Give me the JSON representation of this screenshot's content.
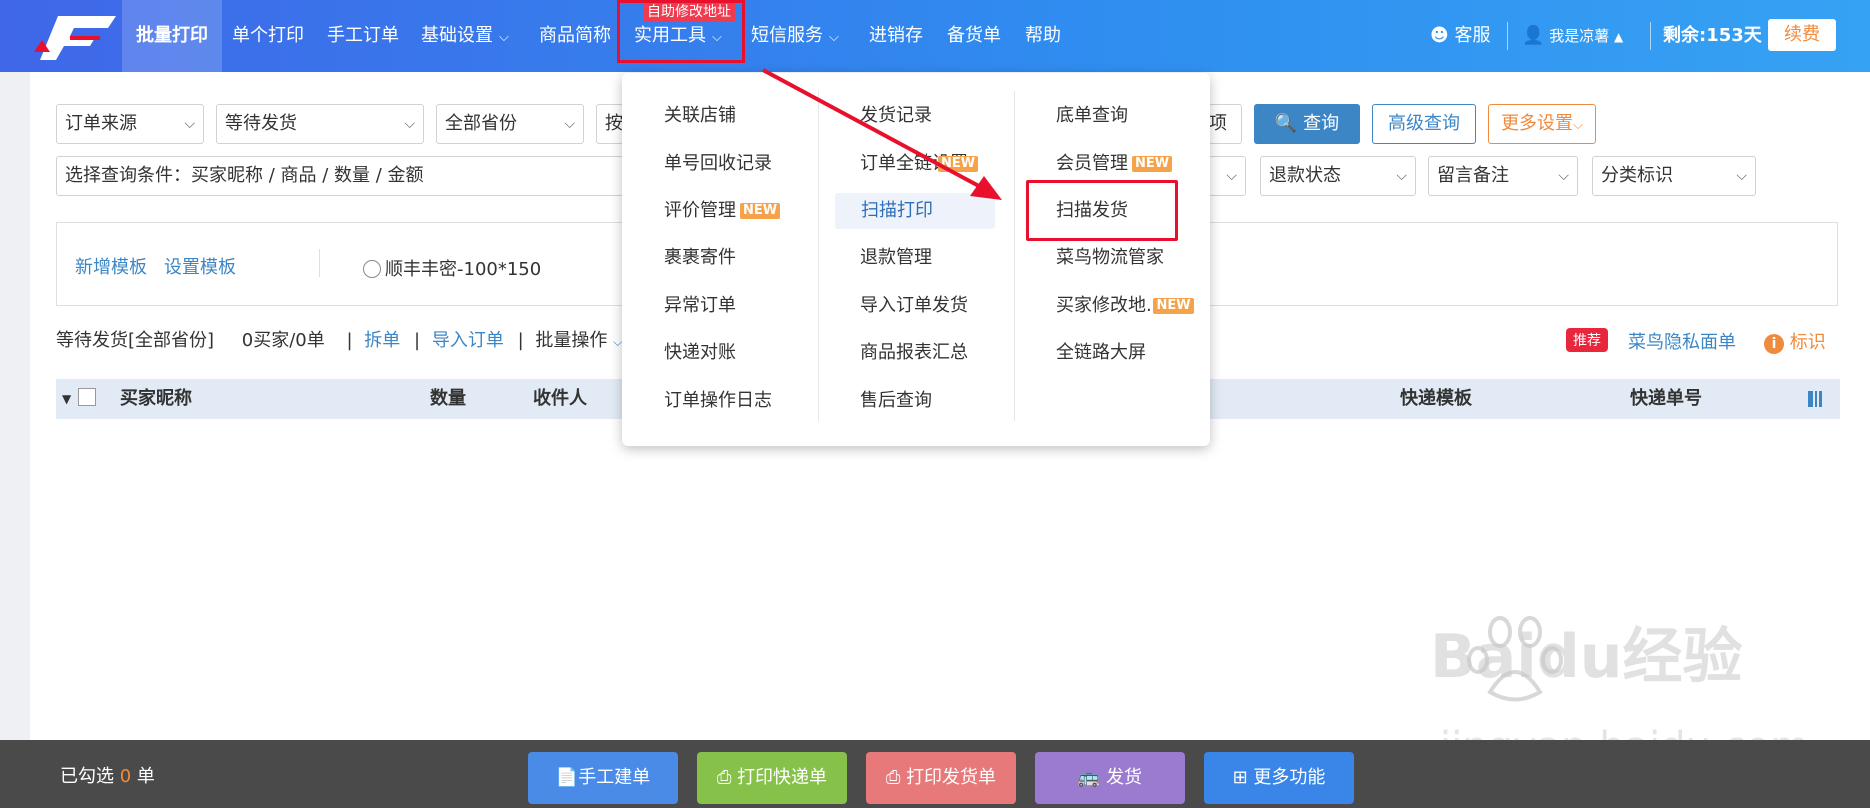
{
  "nav": {
    "items": [
      "批量打印",
      "单个打印",
      "手工订单",
      "基础设置",
      "商品简称",
      "实用工具",
      "短信服务",
      "进销存",
      "备货单",
      "帮助"
    ],
    "top_badge": "自助修改地址",
    "service": "客服",
    "user": "我是凉薯",
    "remaining": "剩余:153天",
    "renew": "续费"
  },
  "filters": {
    "order_source": "订单来源",
    "status": "等待发货",
    "province": "全部省份",
    "partial": "按",
    "item_tail": "项",
    "query": "查询",
    "advanced": "高级查询",
    "more_settings": "更多设置",
    "condition": "选择查询条件：买家昵称 / 商品 / 数量 / 金额",
    "refund": "退款状态",
    "remark": "留言备注",
    "category": "分类标识"
  },
  "template": {
    "add": "新增模板",
    "set": "设置模板",
    "option": "顺丰丰密-100*150"
  },
  "status_row": {
    "label": "等待发货[全部省份]",
    "count": "0买家/0单",
    "split": "拆单",
    "import": "导入订单",
    "batch": "批量操作",
    "recommend_tag": "推荐",
    "cainiao": "菜鸟隐私面单",
    "mark": "标识"
  },
  "table": {
    "headers": [
      "买家昵称",
      "数量",
      "收件人",
      "快递模板",
      "快递单号"
    ]
  },
  "dropdown": {
    "col1": [
      "关联店铺",
      "单号回收记录",
      "评价管理",
      "裹裹寄件",
      "异常订单",
      "快递对账",
      "订单操作日志"
    ],
    "col2": [
      "发货记录",
      "订单全链设置",
      "扫描打印",
      "退款管理",
      "导入订单发货",
      "商品报表汇总",
      "售后查询"
    ],
    "col3": [
      "底单查询",
      "会员管理",
      "扫描发货",
      "菜鸟物流管家",
      "买家修改地..",
      "全链路大屏"
    ],
    "new_label": "NEW"
  },
  "bottom": {
    "selected_prefix": "已勾选",
    "selected_count": "0",
    "selected_suffix": "单",
    "buttons": [
      "手工建单",
      "打印快递单",
      "打印发货单",
      "发货",
      "更多功能"
    ]
  },
  "watermark": {
    "line1": "Baidu经验",
    "line2": "jingyan.baidu.com"
  },
  "colors": {
    "topbar": "#3f67e8",
    "accent_red": "#e8102c",
    "btn_blue": "#4a8be8",
    "btn_green": "#86c24a",
    "btn_red": "#e8797a",
    "btn_purple": "#9b7bd0",
    "btn_more": "#3a86e8"
  }
}
